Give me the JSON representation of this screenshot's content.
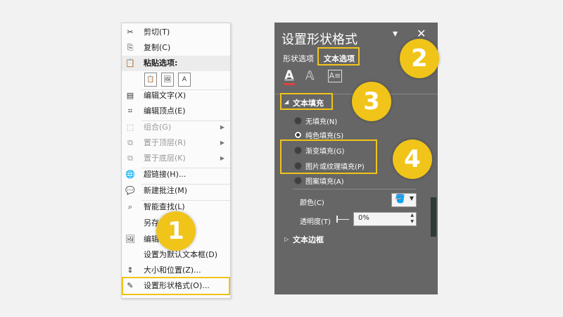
{
  "context_menu": {
    "items": [
      {
        "icon": "scissors-icon",
        "label": "剪切(T)"
      },
      {
        "icon": "copy-icon",
        "label": "复制(C)"
      },
      {
        "icon": "clipboard-icon",
        "label": "粘贴选项:"
      },
      {
        "icon": "edit-text-icon",
        "label": "编辑文字(X)"
      },
      {
        "icon": "edit-points-icon",
        "label": "编辑顶点(E)"
      },
      {
        "icon": "group-icon",
        "label": "组合(G)"
      },
      {
        "icon": "bring-to-front-icon",
        "label": "置于顶层(R)"
      },
      {
        "icon": "send-to-back-icon",
        "label": "置于底层(K)"
      },
      {
        "icon": "hyperlink-icon",
        "label": "超链接(H)..."
      },
      {
        "icon": "new-comment-icon",
        "label": "新建批注(M)"
      },
      {
        "icon": "smart-lookup-icon",
        "label": "智能查找(L)"
      },
      {
        "icon": "",
        "label": "另存"
      },
      {
        "icon": "edit-alt-text-icon",
        "label": "编辑"
      },
      {
        "icon": "",
        "label": "设置为默认文本框(D)"
      },
      {
        "icon": "size-position-icon",
        "label": "大小和位置(Z)..."
      },
      {
        "icon": "format-shape-icon",
        "label": "设置形状格式(O)..."
      }
    ],
    "paste_options": [
      "paste-keep-source-icon",
      "paste-picture-icon",
      "paste-text-only-icon"
    ]
  },
  "format_panel": {
    "title": "设置形状格式",
    "tabs": [
      "形状选项",
      "文本选项"
    ],
    "section_text_fill": "文本填充",
    "fill_options": [
      "无填充(N)",
      "纯色填充(S)",
      "渐变填充(G)",
      "图片或纹理填充(P)",
      "图案填充(A)"
    ],
    "selected_fill": "纯色填充(S)",
    "color_label": "颜色(C)",
    "transparency_label": "透明度(T)",
    "transparency_value": "0%",
    "section_text_outline": "文本边框"
  },
  "badges": [
    "1",
    "2",
    "3",
    "4"
  ],
  "colors": {
    "highlight": "#f0c419",
    "panel_bg": "#666666",
    "text_fill_underline": "#e04040"
  }
}
